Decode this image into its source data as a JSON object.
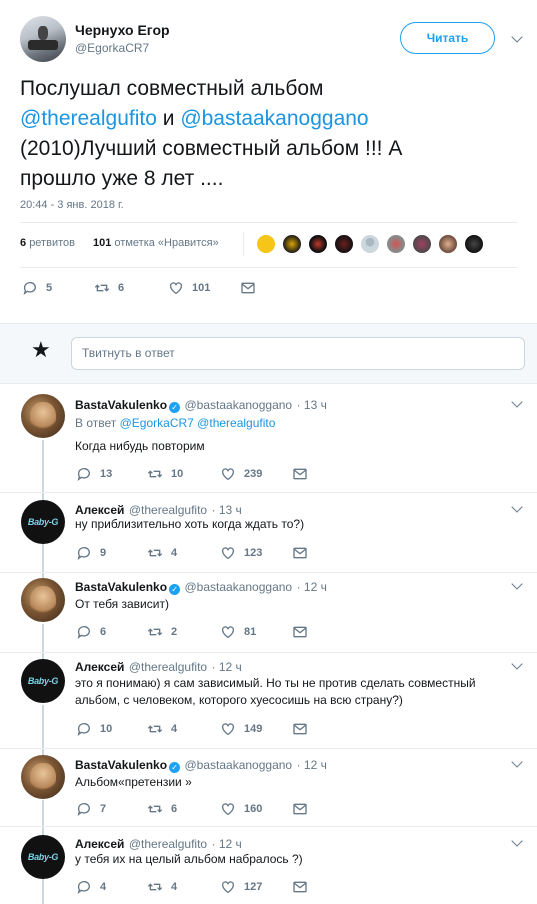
{
  "main_tweet": {
    "author_name": "Чернухо Егор",
    "author_handle": "@EgorkaCR7",
    "follow_label": "Читать",
    "text_line1": "Послушал совместный альбом",
    "mention1": "@therealgufito",
    "conj": " и ",
    "mention2": "@bastaakanoggano",
    "text_line3": "(2010)Лучший совместный альбом !!! А",
    "text_line4": "прошло уже 8 лет ....",
    "timestamp": "20:44 - 3 янв. 2018 г.",
    "retweets_count": "6",
    "retweets_label": "ретвитов",
    "likes_count": "101",
    "likes_label": "отметка «Нравится»",
    "reply_count": "5",
    "retweet_count": "6",
    "like_count": "101"
  },
  "compose": {
    "placeholder": "Твитнуть в ответ"
  },
  "replies": [
    {
      "name": "BastaVakulenko",
      "verified": true,
      "handle": "@bastaakanoggano",
      "time": "· 13 ч",
      "reply_to_label": "В ответ",
      "reply_to_1": "@EgorkaCR7",
      "reply_to_2": "@therealgufito",
      "text": "Когда нибудь повторим",
      "replies": "13",
      "retweets": "10",
      "likes": "239"
    },
    {
      "name": "Алексей",
      "handle": "@therealgufito",
      "time": "· 13 ч",
      "text": "ну приблизительно хоть когда ждать то?)",
      "replies": "9",
      "retweets": "4",
      "likes": "123"
    },
    {
      "name": "BastaVakulenko",
      "verified": true,
      "handle": "@bastaakanoggano",
      "time": "· 12 ч",
      "text": "От тебя зависит)",
      "replies": "6",
      "retweets": "2",
      "likes": "81"
    },
    {
      "name": "Алексей",
      "handle": "@therealgufito",
      "time": "· 12 ч",
      "text_line1": "это я понимаю) я сам зависимый. Но ты не против сделать совместный",
      "text_line2": "альбом, с человеком, которого хуесосишь на всю страну?)",
      "replies": "10",
      "retweets": "4",
      "likes": "149"
    },
    {
      "name": "BastaVakulenko",
      "verified": true,
      "handle": "@bastaakanoggano",
      "time": "· 12 ч",
      "text": "Альбом«претензии »",
      "replies": "7",
      "retweets": "6",
      "likes": "160"
    },
    {
      "name": "Алексей",
      "handle": "@therealgufito",
      "time": "· 12 ч",
      "text": "у тебя их на целый альбом набралось ?)",
      "replies": "4",
      "retweets": "4",
      "likes": "127"
    }
  ],
  "alex_avatar_text": "Baby-G",
  "colors": {
    "accent": "#1da1f2",
    "link": "#1b95e0",
    "muted": "#657786",
    "divider": "#e6ecf0"
  }
}
